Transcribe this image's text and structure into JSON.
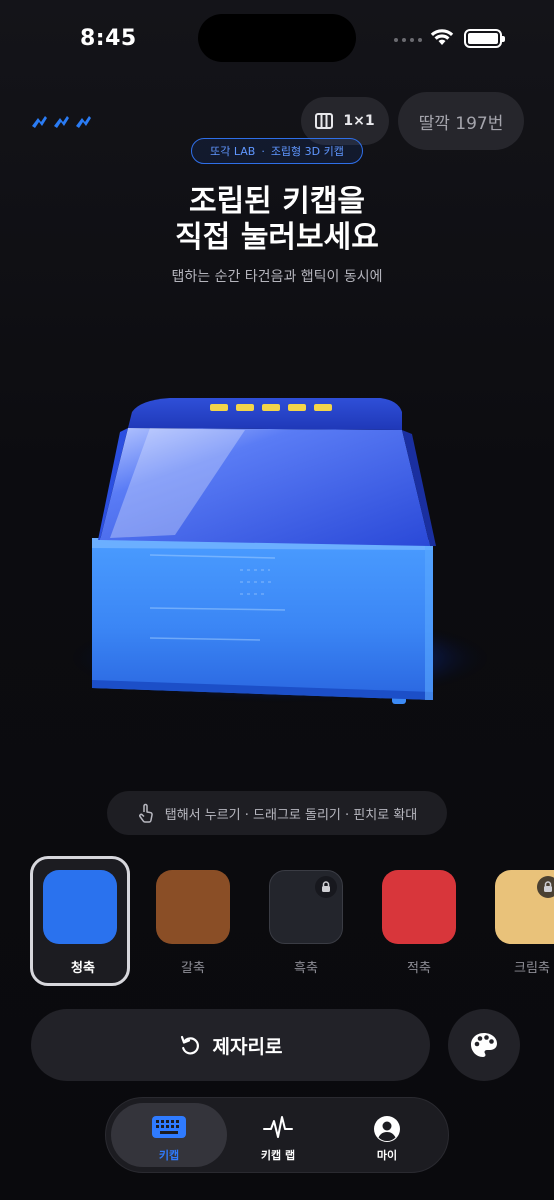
{
  "status_bar": {
    "time": "8:45"
  },
  "header": {
    "grid_label": "1×1",
    "ttak_count": "딸깍 197번",
    "badge_brand": "또각 LAB",
    "badge_dot": "·",
    "badge_desc": "조립형 3D 키캡"
  },
  "hero": {
    "title_line1": "조립된 키캡을",
    "title_line2": "직접 눌러보세요",
    "subtitle": "탭하는 순간 타건음과 햅틱이 동시에"
  },
  "hint": {
    "text": "탭해서 누르기 · 드래그로 돌리기 · 핀치로 확대"
  },
  "swatches": [
    {
      "label": "청축",
      "color": "#2a72ee",
      "locked": false,
      "selected": true
    },
    {
      "label": "갈축",
      "color": "#8a4e26",
      "locked": false,
      "selected": false
    },
    {
      "label": "흑축",
      "color": "#23252c",
      "locked": true,
      "selected": false
    },
    {
      "label": "적축",
      "color": "#d8363b",
      "locked": false,
      "selected": false
    },
    {
      "label": "크림축",
      "color": "#e9c27a",
      "locked": true,
      "selected": false
    }
  ],
  "actions": {
    "reset_label": "제자리로"
  },
  "tabbar": {
    "tabs": [
      {
        "label": "키캡",
        "icon": "keyboard-icon",
        "active": true
      },
      {
        "label": "키캡 랩",
        "icon": "waveform-icon",
        "active": false
      },
      {
        "label": "마이",
        "icon": "profile-icon",
        "active": false
      }
    ]
  },
  "colors": {
    "accent": "#2f7bff",
    "keycap": "#2a72ee",
    "background": "#0c0c10"
  }
}
